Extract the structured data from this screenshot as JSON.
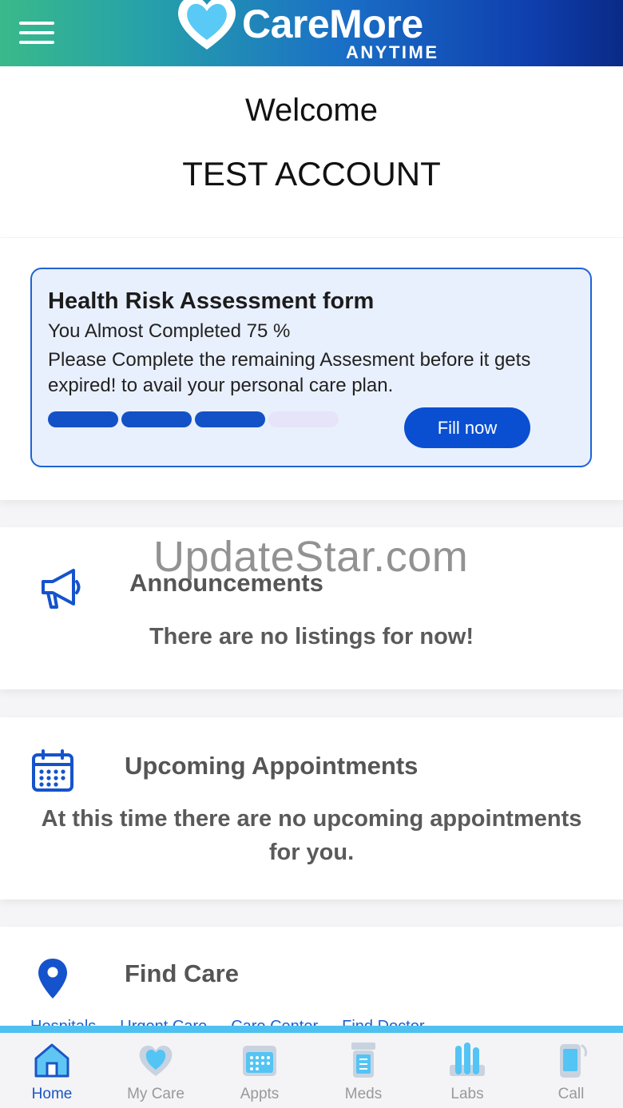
{
  "header": {
    "brand_name": "CareMore",
    "brand_sub": "ANYTIME",
    "gradient_colors": [
      "#3ab98a",
      "#1a6fc6",
      "#0a2a86"
    ]
  },
  "welcome": {
    "greeting": "Welcome",
    "account_name": "TEST ACCOUNT"
  },
  "hra": {
    "title": "Health Risk Assessment form",
    "progress_text": "You Almost Completed 75 %",
    "message": "Please Complete the remaining Assesment before it gets expired! to avail your personal care plan.",
    "progress_segments_filled": 3,
    "progress_segments_total": 4,
    "fill_button": "Fill now",
    "accent_color": "#1351c6"
  },
  "watermark": "UpdateStar.com",
  "announcements": {
    "title": "Announcements",
    "empty_message": "There are no listings for now!",
    "icon": "megaphone-icon"
  },
  "appointments": {
    "title": "Upcoming Appointments",
    "empty_message": "At this time there are no upcoming appointments for you.",
    "icon": "calendar-icon"
  },
  "find_care": {
    "title": "Find Care",
    "icon": "location-pin-icon",
    "links": [
      "Hospitals",
      "Urgent Care",
      "Care Center",
      "Find Doctor"
    ]
  },
  "bottom_nav": {
    "items": [
      {
        "label": "Home",
        "icon": "home-icon",
        "active": true
      },
      {
        "label": "My Care",
        "icon": "heart-icon",
        "active": false
      },
      {
        "label": "Appts",
        "icon": "calendar-icon",
        "active": false
      },
      {
        "label": "Meds",
        "icon": "medicine-bottle-icon",
        "active": false
      },
      {
        "label": "Labs",
        "icon": "test-tubes-icon",
        "active": false
      },
      {
        "label": "Call",
        "icon": "phone-icon",
        "active": false
      }
    ]
  }
}
